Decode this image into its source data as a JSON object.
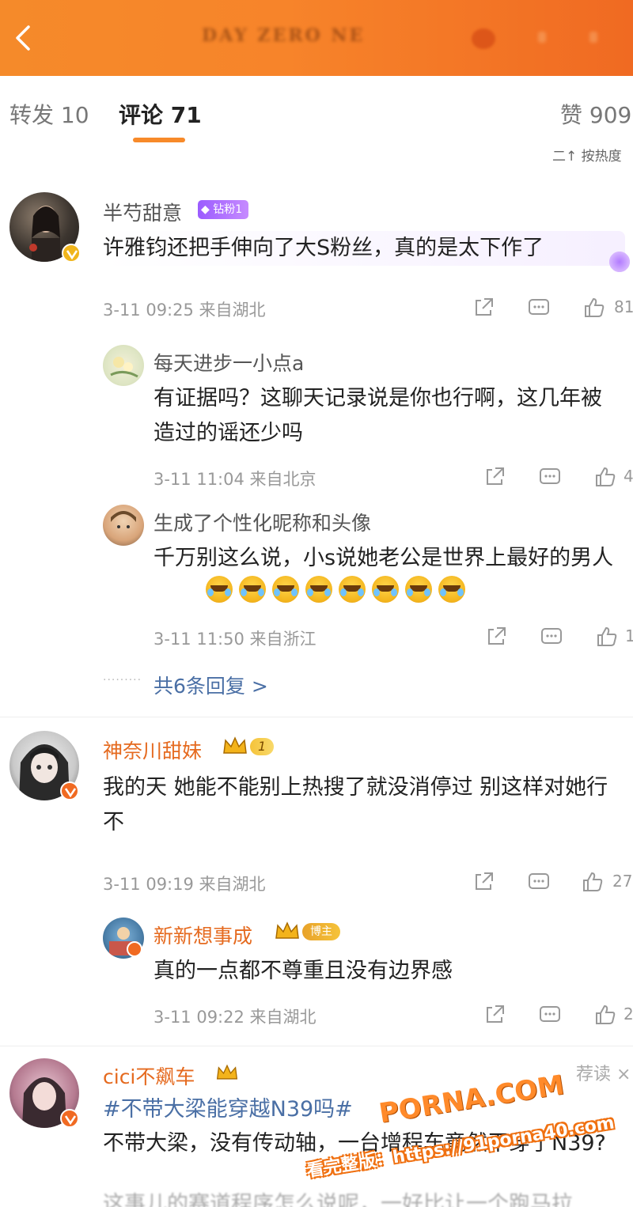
{
  "topbar": {
    "title": "DAY ZERO NE",
    "colors": {
      "banner": "#f7842a"
    }
  },
  "tabs": {
    "forward": "转发 10",
    "comment": "评论 71",
    "like": "赞 909",
    "sort": "二↑ 按热度"
  },
  "comments": [
    {
      "name": "半芍甜意",
      "badge": "钻粉1",
      "text": "许雅钧还把手伸向了大S粉丝，真的是太下作了",
      "meta": "3-11 09:25 来自湖北",
      "like_count": "81",
      "replies": [
        {
          "name": "每天进步一小点a",
          "text": "有证据吗？这聊天记录说是你也行啊，这几年被造过的谣还少吗",
          "meta": "3-11 11:04 来自北京",
          "like_count": "4"
        },
        {
          "name": "生成了个性化昵称和头像",
          "text": "千万别这么说，小s说她老公是世界上最好的男人",
          "meta": "3-11 11:50 来自浙江",
          "like_count": "1"
        }
      ],
      "more_replies": "共6条回复 >"
    },
    {
      "name": "神奈川甜妹",
      "badge": "1",
      "text": "我的天 她能不能别上热搜了就没消停过 别这样对她行不",
      "meta": "3-11 09:19 来自湖北",
      "like_count": "27",
      "replies": [
        {
          "name": "新新想事成",
          "badge": "博主",
          "text": "真的一点都不尊重且没有边界感",
          "meta": "3-11 09:22 来自湖北",
          "like_count": "2"
        }
      ]
    },
    {
      "name": "cici不飙车",
      "recommend": "荐读 ×",
      "tag": "#不带大梁能穿越N39吗#",
      "text": "不带大梁，没有传动轴，一台增程车竟然干穿了N39?",
      "text_tail": "这事儿的赛道程序怎么说呢，一好比让一个跑马拉"
    }
  ],
  "watermark": {
    "brand": "PORNA.COM",
    "line": "看完整版：https://91porna40.com"
  }
}
